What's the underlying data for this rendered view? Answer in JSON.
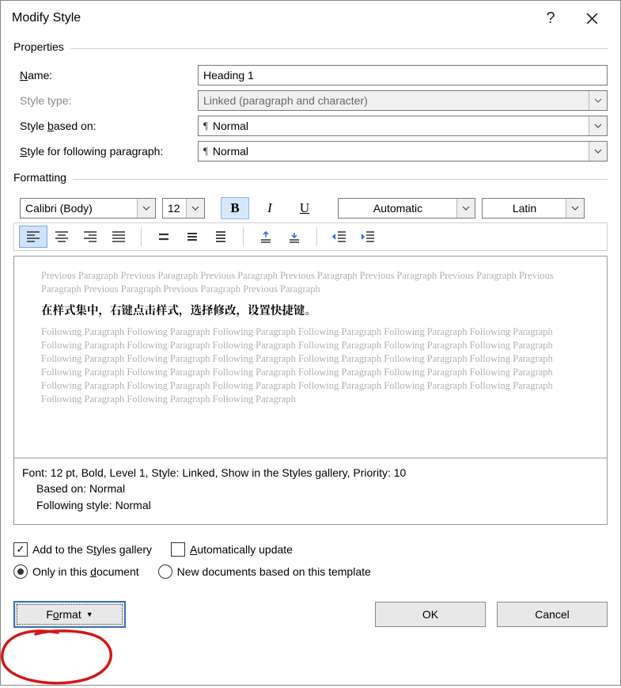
{
  "title": "Modify Style",
  "groups": {
    "properties": "Properties",
    "formatting": "Formatting"
  },
  "properties": {
    "name_label_pre": "N",
    "name_label_post": "ame:",
    "name_value": "Heading 1",
    "styletype_label": "Style type:",
    "styletype_value": "Linked (paragraph and character)",
    "basedon_label_pre": "Style ",
    "basedon_label_u": "b",
    "basedon_label_post": "ased on:",
    "basedon_value": "Normal",
    "following_label_u": "S",
    "following_label_post": "tyle for following paragraph:",
    "following_value": "Normal"
  },
  "formatting": {
    "font_name": "Calibri (Body)",
    "font_size": "12",
    "bold": "B",
    "italic": "I",
    "underline": "U",
    "color_label": "Automatic",
    "script_label": "Latin"
  },
  "preview": {
    "prev": "Previous Paragraph Previous Paragraph Previous Paragraph Previous Paragraph Previous Paragraph Previous Paragraph Previous Paragraph Previous Paragraph Previous Paragraph Previous Paragraph",
    "sample": "在样式集中，右键点击样式，选择修改，设置快捷键。",
    "following": "Following Paragraph Following Paragraph Following Paragraph Following Paragraph Following Paragraph Following Paragraph Following Paragraph Following Paragraph Following Paragraph Following Paragraph Following Paragraph Following Paragraph Following Paragraph Following Paragraph Following Paragraph Following Paragraph Following Paragraph Following Paragraph Following Paragraph Following Paragraph Following Paragraph Following Paragraph Following Paragraph Following Paragraph Following Paragraph Following Paragraph Following Paragraph Following Paragraph Following Paragraph Following Paragraph Following Paragraph Following Paragraph Following Paragraph"
  },
  "description": {
    "line1": "Font: 12 pt, Bold, Level 1, Style: Linked, Show in the Styles gallery, Priority: 10",
    "line2": "Based on: Normal",
    "line3": "Following style: Normal"
  },
  "options": {
    "add_gallery_pre": "Add to the S",
    "add_gallery_u": "t",
    "add_gallery_post": "yles gallery",
    "auto_update_u": "A",
    "auto_update_post": "utomatically update",
    "only_doc_pre": "Only in this ",
    "only_doc_u": "d",
    "only_doc_post": "ocument",
    "new_docs": "New documents based on this template"
  },
  "buttons": {
    "format_pre": "F",
    "format_u": "o",
    "format_post": "rmat",
    "ok": "OK",
    "cancel": "Cancel"
  }
}
